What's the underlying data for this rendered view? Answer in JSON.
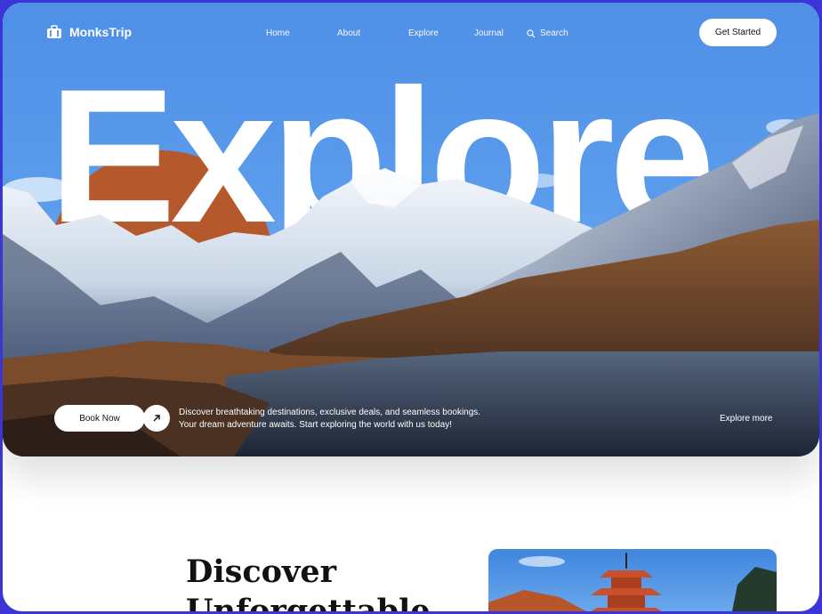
{
  "brand": {
    "name": "MonksTrip",
    "icon": "suitcase-icon"
  },
  "nav": {
    "links": [
      "Home",
      "About",
      "Explore",
      "Journal"
    ],
    "search_label": "Search",
    "cta_label": "Get Started"
  },
  "hero": {
    "headline": "Explore",
    "book_label": "Book Now",
    "description_line1": "Discover breathtaking destinations, exclusive deals, and seamless bookings.",
    "description_line2": "Your dream adventure awaits. Start exploring the world with us today!",
    "explore_more_label": "Explore more"
  },
  "section": {
    "heading_line1": "Discover",
    "heading_line2": "Unforgettable"
  },
  "colors": {
    "frame": "#3b35d6",
    "sky": "#5b9cec",
    "sun": "#b5582c",
    "text_light": "#ffffff"
  }
}
